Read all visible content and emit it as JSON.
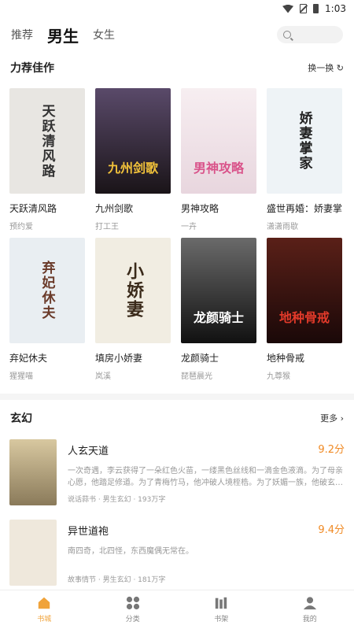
{
  "status": {
    "time": "1:03"
  },
  "topbar": {
    "tabs": [
      "推荐",
      "男生",
      "女生"
    ],
    "active": "男生"
  },
  "featured": {
    "title": "力荐佳作",
    "action": "换一换 ↻",
    "books": [
      {
        "title": "天跃清风路",
        "author": "预约爱",
        "cover_text": "天跃清风路",
        "bg": "#e8e6e2",
        "fg": "#333333"
      },
      {
        "title": "九州剑歌",
        "author": "打工王",
        "cover_text": "九州剑歌",
        "bg": "#2b2430",
        "fg": "#f2c23a"
      },
      {
        "title": "男神攻略",
        "author": "一卉",
        "cover_text": "男神攻略",
        "bg": "#f3e4ea",
        "fg": "#d9538a"
      },
      {
        "title": "盛世再婚：娇妻掌",
        "author": "潇潇雨歇",
        "cover_text": "娇妻掌家",
        "bg": "#eef3f6",
        "fg": "#222222"
      },
      {
        "title": "弃妃休夫",
        "author": "猩猩喵",
        "cover_text": "弃妃休夫",
        "bg": "#e9eef2",
        "fg": "#6a3a2a"
      },
      {
        "title": "填房小娇妻",
        "author": "岚溪",
        "cover_text": "小娇妻",
        "bg": "#f1ede2",
        "fg": "#3a2a1a"
      },
      {
        "title": "龙颜骑士",
        "author": "琵琶晨光",
        "cover_text": "龙颜骑士",
        "bg": "#1f1f1f",
        "fg": "#ffffff"
      },
      {
        "title": "地种骨戒",
        "author": "九尊猴",
        "cover_text": "地种骨戒",
        "bg": "#3a1410",
        "fg": "#e23a2a"
      }
    ]
  },
  "genre": {
    "title": "玄幻",
    "action": "更多 ›",
    "items": [
      {
        "title": "人玄天道",
        "score": "9.2分",
        "desc": "一次奇遇，李云获得了一朵红色火苗，一缕黑色丝线和一滴金色液滴。为了母亲心愿，他踏足修道。为了青梅竹马，他冲破人境桎梏。为了妖媚一族，他破玄…",
        "meta": "说话蒜书 · 男生玄幻 · 193万字",
        "bg": "#c9b48a"
      },
      {
        "title": "异世道袍",
        "score": "9.4分",
        "desc": "南四奇，北四怪，东西魔偶无常在。",
        "meta": "故事情节 · 男生玄幻 · 181万字",
        "bg": "#efe8dc"
      }
    ]
  },
  "nav": [
    {
      "label": "书城",
      "icon": "home-icon",
      "active": true
    },
    {
      "label": "分类",
      "icon": "category-icon",
      "active": false
    },
    {
      "label": "书架",
      "icon": "bookshelf-icon",
      "active": false
    },
    {
      "label": "我的",
      "icon": "profile-icon",
      "active": false
    }
  ],
  "colors": {
    "accent": "#f0a33a",
    "score": "#f08a24"
  }
}
